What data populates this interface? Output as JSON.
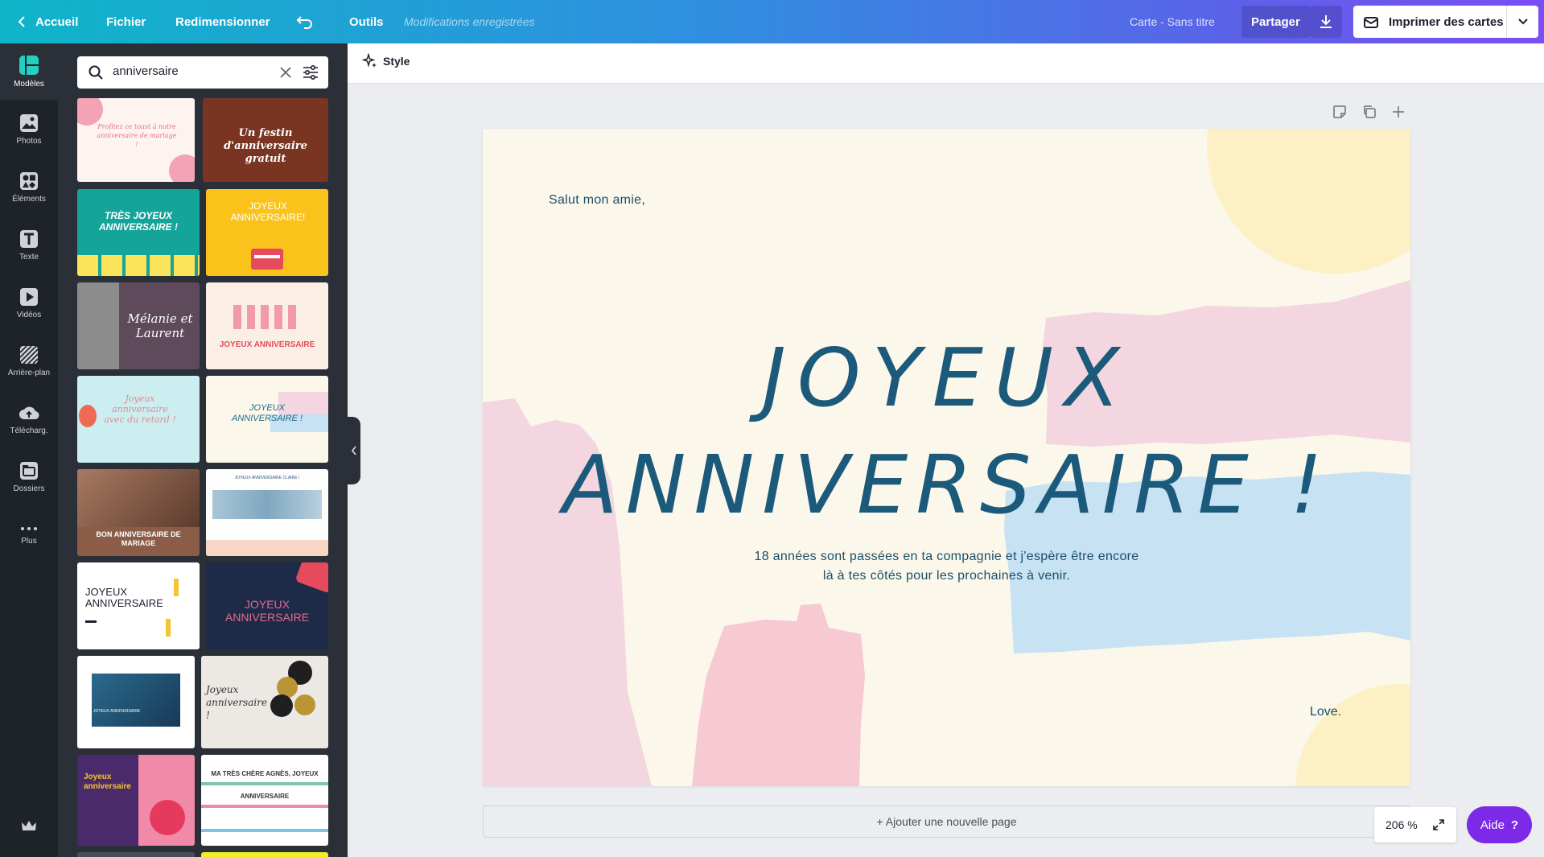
{
  "topbar": {
    "home": "Accueil",
    "file": "Fichier",
    "resize": "Redimensionner",
    "tools": "Outils",
    "saved_status": "Modifications enregistrées",
    "doc_title": "Carte - Sans titre",
    "share": "Partager",
    "print": "Imprimer des cartes"
  },
  "rail": {
    "items": [
      {
        "label": "Modèles",
        "icon": "templates-icon"
      },
      {
        "label": "Photos",
        "icon": "photos-icon"
      },
      {
        "label": "Éléments",
        "icon": "elements-icon"
      },
      {
        "label": "Texte",
        "icon": "text-icon"
      },
      {
        "label": "Vidéos",
        "icon": "videos-icon"
      },
      {
        "label": "Arrière-plan",
        "icon": "background-icon"
      },
      {
        "label": "Télécharg.",
        "icon": "upload-icon"
      },
      {
        "label": "Dossiers",
        "icon": "folders-icon"
      },
      {
        "label": "Plus",
        "icon": "more-icon"
      }
    ]
  },
  "search": {
    "value": "anniversaire"
  },
  "templates": [
    {
      "title": "Profitez ce toast à notre anniversaire de mariage !",
      "bg": "#fdf4f0",
      "fg": "#e86b8a"
    },
    {
      "title": "Un festin d'anniversaire gratuit",
      "bg": "#7a3522",
      "fg": "#ffffff"
    },
    {
      "title": "TRÈS JOYEUX ANNIVERSAIRE !",
      "bg": "#15a49a",
      "fg": "#ffffff"
    },
    {
      "title": "JOYEUX ANNIVERSAIRE!",
      "bg": "#f9c31b",
      "fg": "#ffffff"
    },
    {
      "title": "Mélanie et Laurent",
      "bg": "#5e4a5a",
      "fg": "#ffffff"
    },
    {
      "title": "JOYEUX ANNIVERSAIRE",
      "bg": "#fbeee4",
      "fg": "#e64b5d"
    },
    {
      "title": "Joyeux anniversaire avec du retard !",
      "bg": "#cdeef1",
      "fg": "#e28a8a"
    },
    {
      "title": "JOYEUX ANNIVERSAIRE !",
      "bg": "#fbf7ea",
      "fg": "#1f6a8a"
    },
    {
      "title": "BON ANNIVERSAIRE DE MARIAGE",
      "bg": "#8b5d49",
      "fg": "#ffffff"
    },
    {
      "title": "JOYEUX ANNIVERSAIRE CLAIRE !",
      "bg": "#fdfdfb",
      "fg": "#2d5c88"
    },
    {
      "title": "JOYEUX ANNIVERSAIRE",
      "bg": "#ffffff",
      "fg": "#1f1f2e"
    },
    {
      "title": "JOYEUX ANNIVERSAIRE",
      "bg": "#1d2a48",
      "fg": "#e86b8a"
    },
    {
      "title": "JOYEUX ANNIVERSAIRE",
      "bg": "#ffffff",
      "fg": "#2c6a8e"
    },
    {
      "title": "Joyeux anniversaire !",
      "bg": "#ece9e4",
      "fg": "#333333"
    },
    {
      "title": "Joyeux anniversaire",
      "bg": "#4a2a6b",
      "fg": "#f4c531"
    },
    {
      "title": "MA TRÈS CHÈRE AGNÈS, JOYEUX ANNIVERSAIRE",
      "bg": "#ffffff",
      "fg": "#333333"
    }
  ],
  "toolbar": {
    "style": "Style"
  },
  "card": {
    "greeting": "Salut mon amie,",
    "headline_1": "JOYEUX",
    "headline_2": "ANNIVERSAIRE !",
    "body_1": "18 années sont passées en ta compagnie et j'espère être encore",
    "body_2": "là à tes côtés pour les prochaines à venir.",
    "signoff": "Love."
  },
  "add_page": "+ Ajouter une nouvelle page",
  "zoom": "206 %",
  "help": "Aide",
  "colors": {
    "rail_bg": "#1e2229",
    "panel_bg": "#2a2f38",
    "accent_purple": "#7d2ae8",
    "headline_blue": "#1b5a7a",
    "brush_pink": "#f3d6df",
    "brush_blue": "#c6e2f3",
    "brush_yellow": "#fdf0c4"
  }
}
